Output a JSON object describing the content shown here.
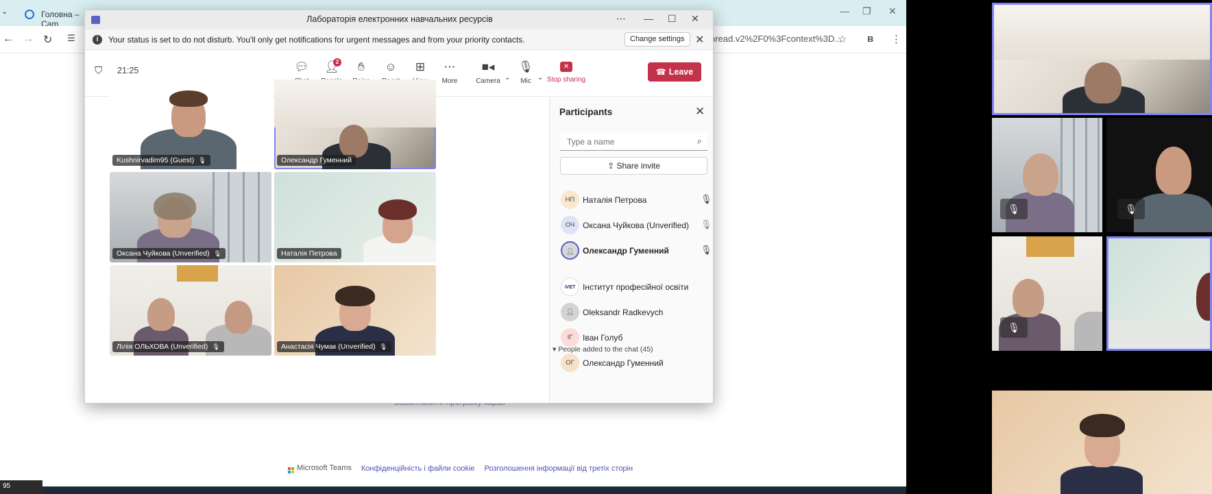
{
  "browser": {
    "tab_title": "Головна – Cam",
    "url_fragment": "hread.v2%2F0%3Fcontext%3D...",
    "hidden_text": "Завантажити програму зараз",
    "footer": {
      "brand": "Microsoft Teams",
      "link_privacy": "Конфіденційність і файли cookie",
      "link_third_party": "Розголошення інформації від третіх сторін"
    },
    "taskbar_time_fragment": "95"
  },
  "teams": {
    "window_title": "Лабораторія електронних навчальних ресурсів",
    "banner": {
      "message": "Your status is set to do not disturb. You'll only get notifications for urgent messages and from your priority contacts.",
      "change_settings": "Change settings"
    },
    "timer": "21:25",
    "toolbar": {
      "chat": "Chat",
      "people": "People",
      "people_badge": "2",
      "raise": "Raise",
      "react": "React",
      "view": "View",
      "more": "More",
      "camera": "Camera",
      "mic": "Mic",
      "stop_sharing": "Stop sharing",
      "leave": "Leave"
    },
    "tiles": [
      {
        "name": "Kushnirvadim95 (Guest)",
        "muted": true
      },
      {
        "name": "Олександр Гуменний",
        "muted": false
      },
      {
        "name": "Оксана Чуйкова (Unverified)",
        "muted": true
      },
      {
        "name": "Наталія Петрова",
        "muted": false
      },
      {
        "name": "Лілія ОЛЬХОВА (Unverified)",
        "muted": true
      },
      {
        "name": "Анастасія Чумак (Unverified)",
        "muted": true
      }
    ],
    "participants": {
      "title": "Participants",
      "search_placeholder": "Type a name",
      "share_invite": "Share invite",
      "in_meeting": [
        {
          "initials": "НП",
          "name": "Наталія Петрова",
          "mic": "on"
        },
        {
          "initials": "ОЧ",
          "name": "Оксана Чуйкова (Unverified)",
          "mic": "off"
        },
        {
          "initials": "",
          "name": "Олександр Гуменний",
          "mic": "on"
        }
      ],
      "section_label": "People added to the chat (45)",
      "added": [
        {
          "initials": "iVET",
          "name": "Інститут професійної освіти"
        },
        {
          "initials": "",
          "name": "Oleksandr Radkevych"
        },
        {
          "initials": "ІГ",
          "name": "Іван Голуб"
        },
        {
          "initials": "ОГ",
          "name": "Олександр Гуменний"
        }
      ]
    }
  },
  "colors": {
    "accent": "#5b5fc7",
    "leave": "#c4314b",
    "selection_border": "#7f85f5"
  }
}
